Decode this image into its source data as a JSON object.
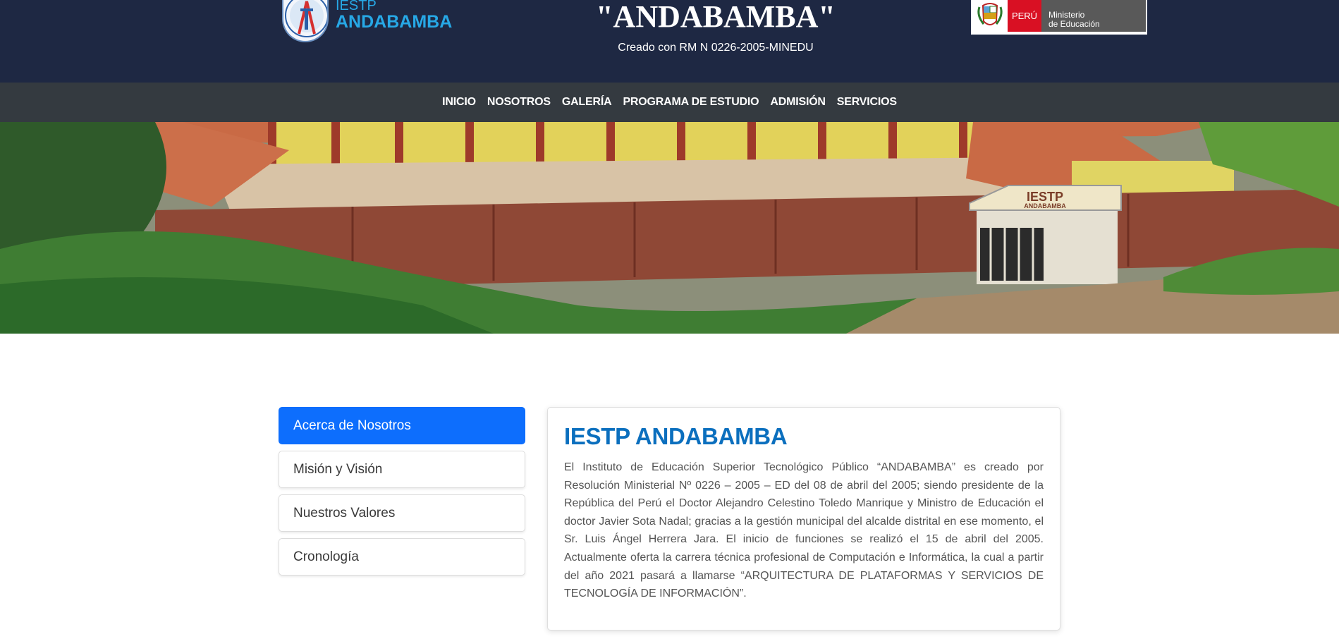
{
  "header": {
    "logo_line1": "IESTP",
    "logo_line2": "ANDABAMBA",
    "title": "\"ANDABAMBA\"",
    "subtitle": "Creado con RM N 0226-2005-MINEDU",
    "minedu": {
      "country": "PERÚ",
      "line1": "Ministerio",
      "line2": "de Educación"
    }
  },
  "nav": {
    "items": [
      "INICIO",
      "NOSOTROS",
      "GALERÍA",
      "PROGRAMA DE ESTUDIO",
      "ADMISIÓN",
      "SERVICIOS"
    ]
  },
  "sidebar": {
    "items": [
      {
        "label": "Acerca de Nosotros",
        "active": true
      },
      {
        "label": "Misión y Visión"
      },
      {
        "label": "Nuestros Valores"
      },
      {
        "label": "Cronología"
      }
    ]
  },
  "content": {
    "heading": "IESTP ANDABAMBA",
    "body": "El Instituto de Educación Superior Tecnológico Público “ANDABAMBA” es creado por Resolución Ministerial Nº 0226 – 2005 – ED del 08 de abril del 2005; siendo presidente de la República del Perú el Doctor Alejandro Celestino Toledo Manrique y Ministro de Educación el doctor Javier Sota Nadal; gracias a la gestión municipal del alcalde distrital en ese momento, el Sr. Luis Ángel Herrera Jara. El inicio de funciones se realizó el 15 de abril del 2005. Actualmente oferta la carrera técnica profesional de Computación e Informática, la cual a partir del año 2021 pasará a llamarse “ARQUITECTURA DE PLATAFORMAS Y SERVICIOS DE TECNOLOGÍA DE INFORMACIÓN”."
  },
  "banner": {
    "sign_line1": "IESTP",
    "sign_line2": "ANDABAMBA"
  },
  "colors": {
    "header_bg": "#1e2843",
    "nav_bg": "#343a40",
    "accent": "#0d6efd",
    "heading": "#0b6fbe",
    "logo_text": "#27a8e6"
  }
}
